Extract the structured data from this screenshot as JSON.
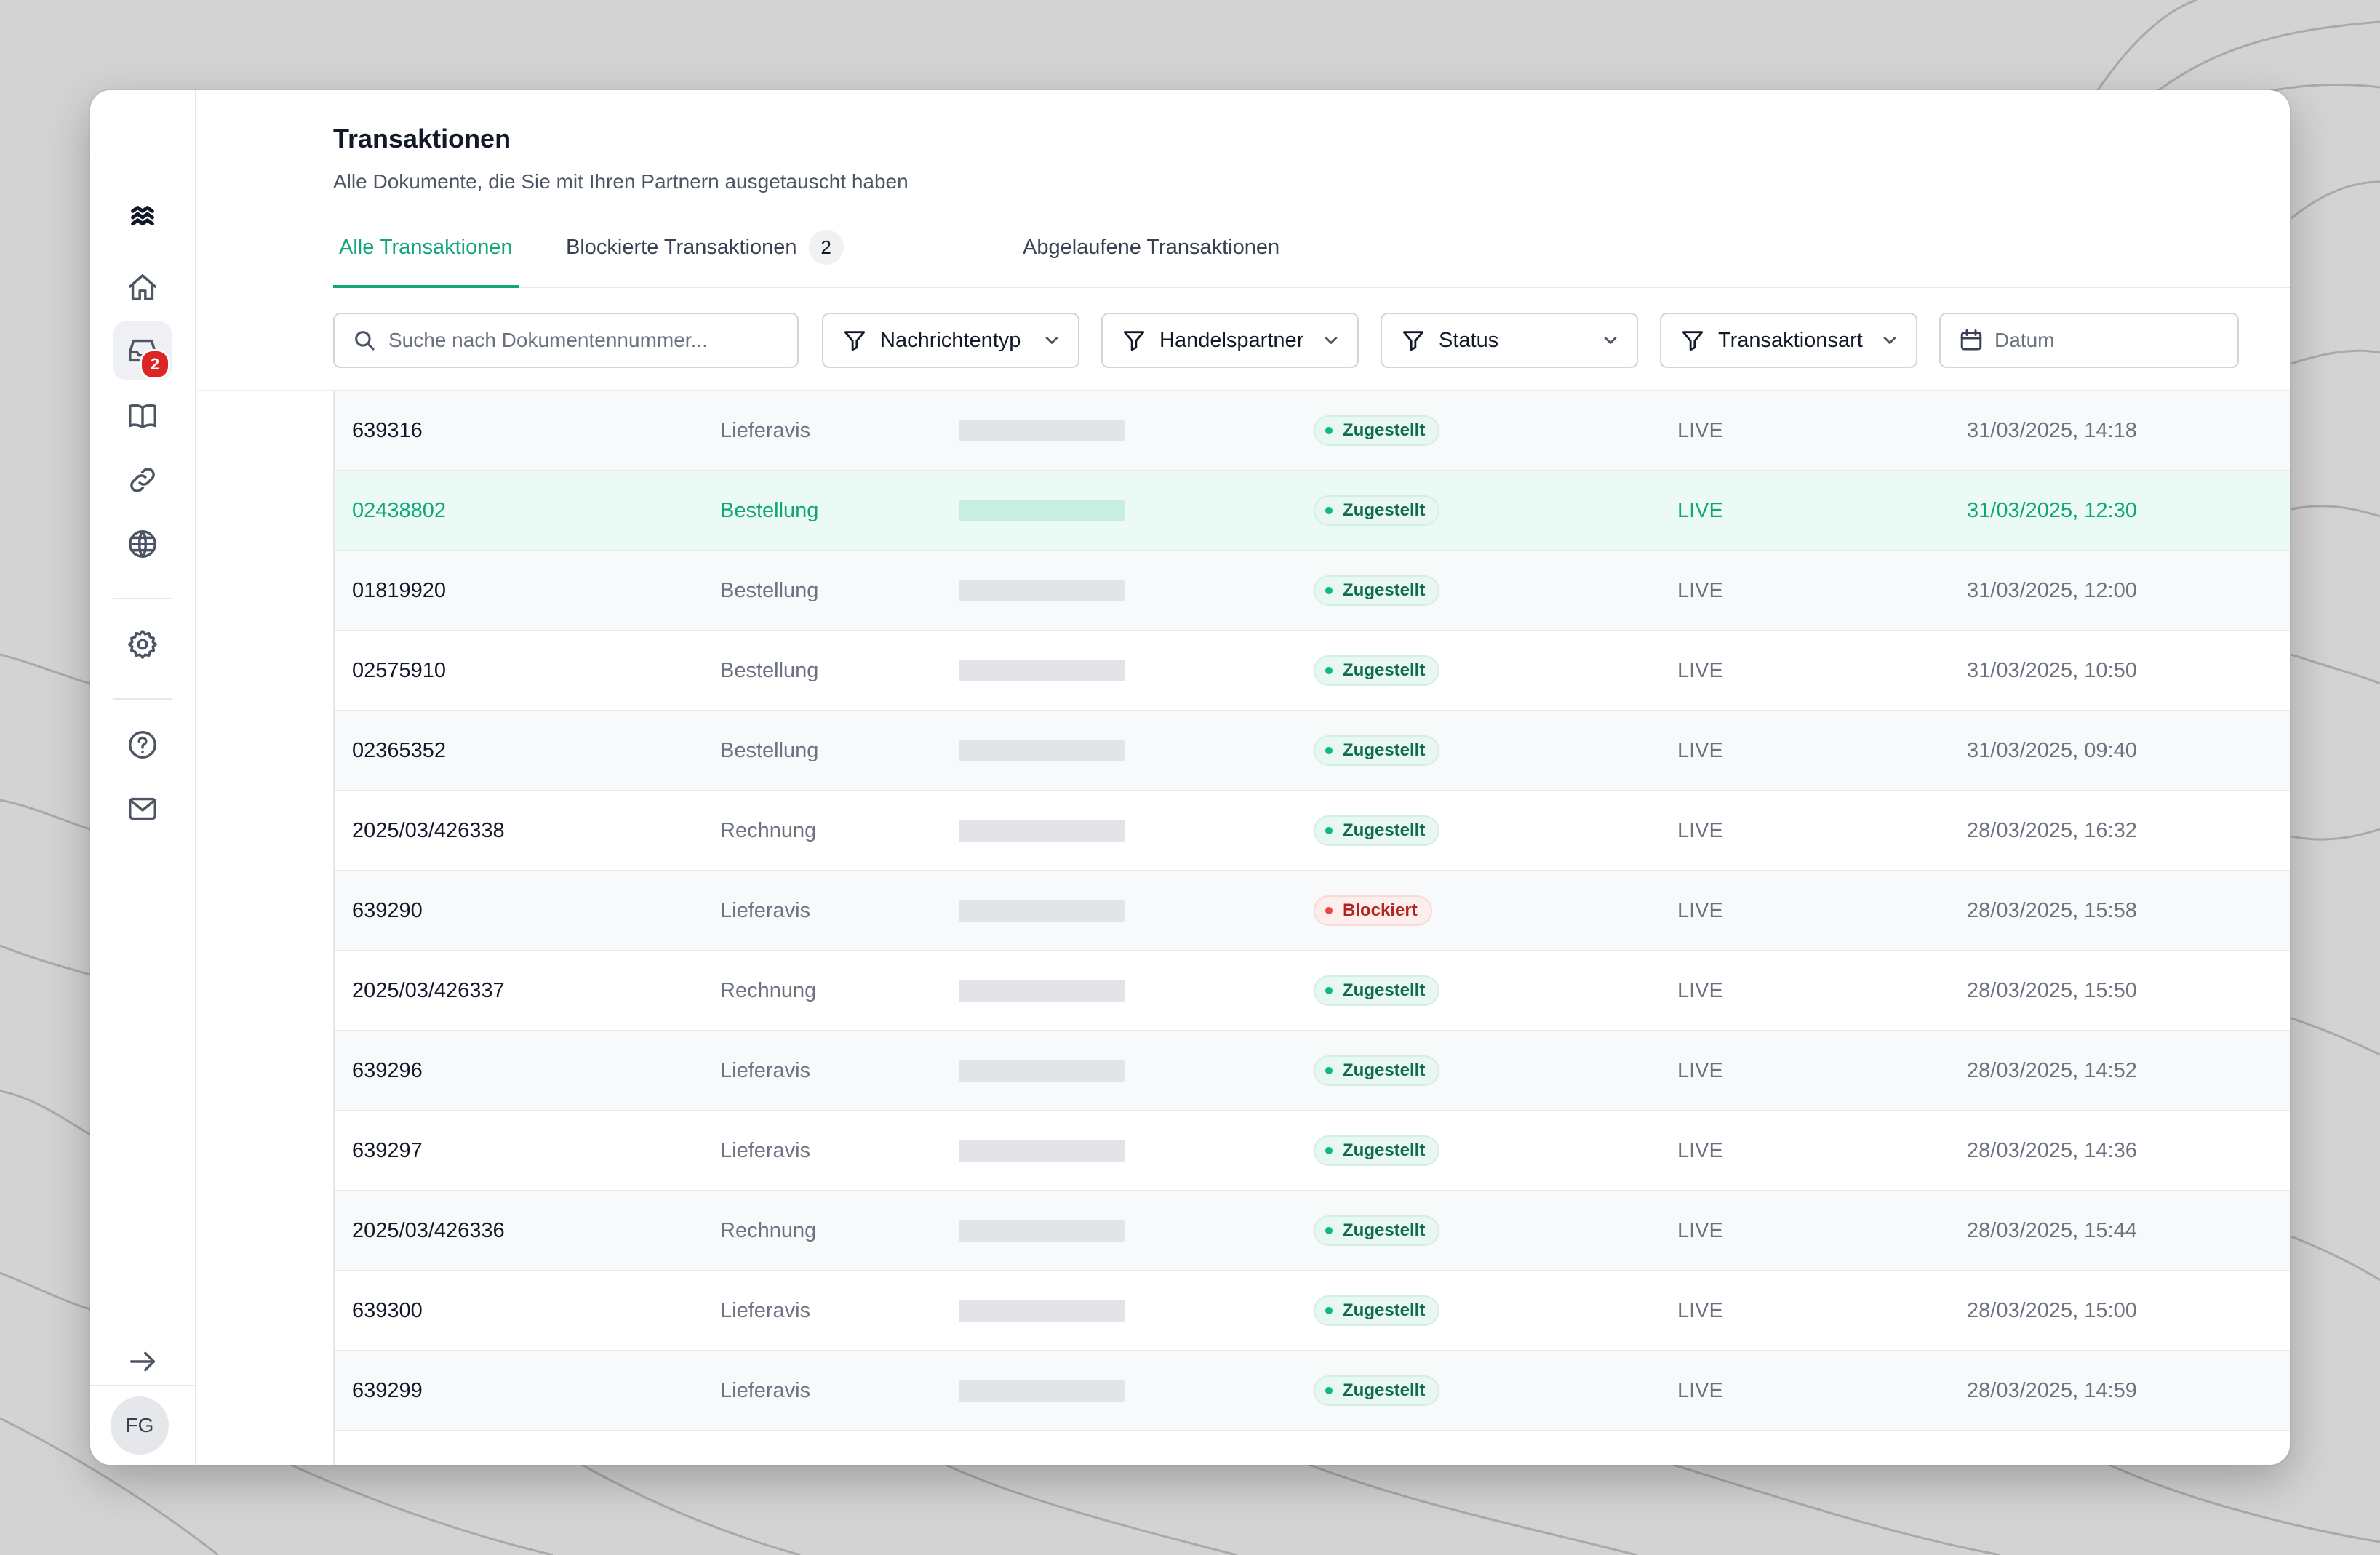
{
  "header": {
    "title": "Transaktionen",
    "subtitle": "Alle Dokumente, die Sie mit Ihren Partnern ausgetauscht haben"
  },
  "tabs": [
    {
      "label": "Alle Transaktionen",
      "active": true
    },
    {
      "label": "Blockierte Transaktionen",
      "count": "2"
    },
    {
      "label": "Abgelaufene Transaktionen"
    }
  ],
  "filters": {
    "search_placeholder": "Suche nach Dokumentennummer...",
    "message_type": "Nachrichtentyp",
    "trading_partner": "Handelspartner",
    "status": "Status",
    "transaction_type": "Transaktionsart",
    "date_placeholder": "Datum"
  },
  "sidebar": {
    "inbox_badge": "2",
    "avatar_initials": "FG",
    "icons": [
      "logo-icon",
      "home-icon",
      "inbox-icon",
      "book-icon",
      "link-icon",
      "globe-icon",
      "settings-icon",
      "help-icon",
      "mail-icon",
      "arrow-right-icon"
    ]
  },
  "colors": {
    "accent": "#10a57a",
    "delivered": "#10b981",
    "blocked": "#ef4444"
  },
  "rows": [
    {
      "id": "639316",
      "type": "Lieferavis",
      "status": "Zugestellt",
      "status_kind": "ok",
      "env": "LIVE",
      "date": "31/03/2025, 14:18"
    },
    {
      "id": "02438802",
      "type": "Bestellung",
      "status": "Zugestellt",
      "status_kind": "ok",
      "env": "LIVE",
      "date": "31/03/2025, 12:30",
      "highlight": true
    },
    {
      "id": "01819920",
      "type": "Bestellung",
      "status": "Zugestellt",
      "status_kind": "ok",
      "env": "LIVE",
      "date": "31/03/2025, 12:00"
    },
    {
      "id": "02575910",
      "type": "Bestellung",
      "status": "Zugestellt",
      "status_kind": "ok",
      "env": "LIVE",
      "date": "31/03/2025, 10:50"
    },
    {
      "id": "02365352",
      "type": "Bestellung",
      "status": "Zugestellt",
      "status_kind": "ok",
      "env": "LIVE",
      "date": "31/03/2025, 09:40"
    },
    {
      "id": "2025/03/426338",
      "type": "Rechnung",
      "status": "Zugestellt",
      "status_kind": "ok",
      "env": "LIVE",
      "date": "28/03/2025, 16:32"
    },
    {
      "id": "639290",
      "type": "Lieferavis",
      "status": "Blockiert",
      "status_kind": "blocked",
      "env": "LIVE",
      "date": "28/03/2025, 15:58"
    },
    {
      "id": "2025/03/426337",
      "type": "Rechnung",
      "status": "Zugestellt",
      "status_kind": "ok",
      "env": "LIVE",
      "date": "28/03/2025, 15:50"
    },
    {
      "id": "639296",
      "type": "Lieferavis",
      "status": "Zugestellt",
      "status_kind": "ok",
      "env": "LIVE",
      "date": "28/03/2025, 14:52"
    },
    {
      "id": "639297",
      "type": "Lieferavis",
      "status": "Zugestellt",
      "status_kind": "ok",
      "env": "LIVE",
      "date": "28/03/2025, 14:36"
    },
    {
      "id": "2025/03/426336",
      "type": "Rechnung",
      "status": "Zugestellt",
      "status_kind": "ok",
      "env": "LIVE",
      "date": "28/03/2025, 15:44"
    },
    {
      "id": "639300",
      "type": "Lieferavis",
      "status": "Zugestellt",
      "status_kind": "ok",
      "env": "LIVE",
      "date": "28/03/2025, 15:00"
    },
    {
      "id": "639299",
      "type": "Lieferavis",
      "status": "Zugestellt",
      "status_kind": "ok",
      "env": "LIVE",
      "date": "28/03/2025, 14:59"
    }
  ]
}
